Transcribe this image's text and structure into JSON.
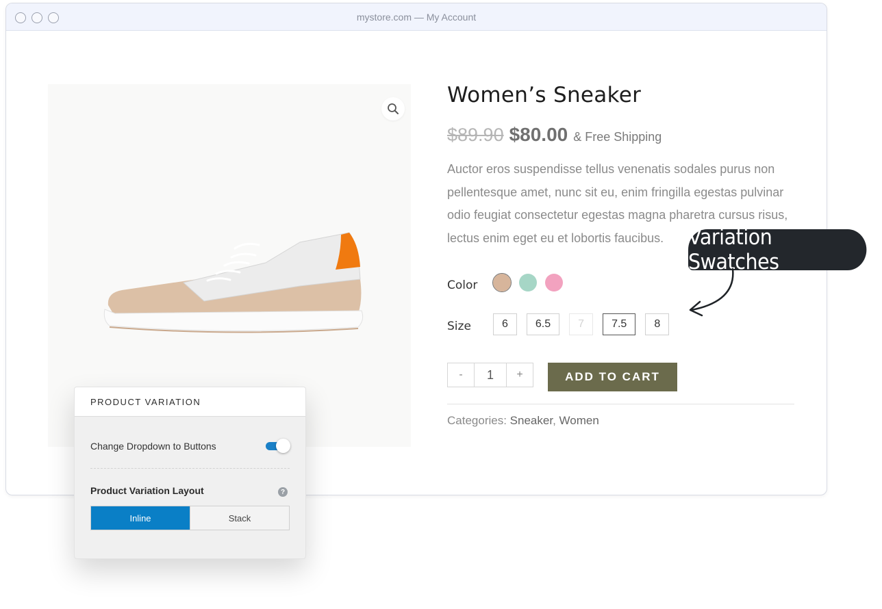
{
  "window": {
    "url": "mystore.com — My Account"
  },
  "product": {
    "title": "Women’s  Sneaker",
    "old_price": "$89.90",
    "price": "$80.00",
    "shipping": "& Free Shipping",
    "description": "Auctor eros suspendisse tellus venenatis sodales purus non pellentesque amet, nunc sit eu, enim fringilla egestas pulvinar odio feugiat consectetur egestas magna pharetra cursus risus, lectus enim eget eu et lobortis faucibus.",
    "color_label": "Color",
    "colors": [
      "#d7b59b",
      "#a6d6c6",
      "#f2a2bf"
    ],
    "size_label": "Size",
    "sizes": [
      "6",
      "6.5",
      "7",
      "7.5",
      "8"
    ],
    "quantity": "1",
    "minus": "-",
    "plus": "+",
    "add_to_cart": "ADD TO CART",
    "categories_label": "Categories:",
    "categories": [
      "Sneaker",
      "Women"
    ],
    "category_separator": ","
  },
  "callout": {
    "text": "Variation Swatches"
  },
  "panel": {
    "header": "PRODUCT VARIATION",
    "toggle_label": "Change Dropdown to Buttons",
    "layout_label": "Product Variation Layout",
    "help": "?",
    "options": [
      "Inline",
      "Stack"
    ]
  },
  "colors": {
    "button": "#6b6b4c",
    "accent": "#0a7fc6",
    "callout": "#23272c"
  }
}
